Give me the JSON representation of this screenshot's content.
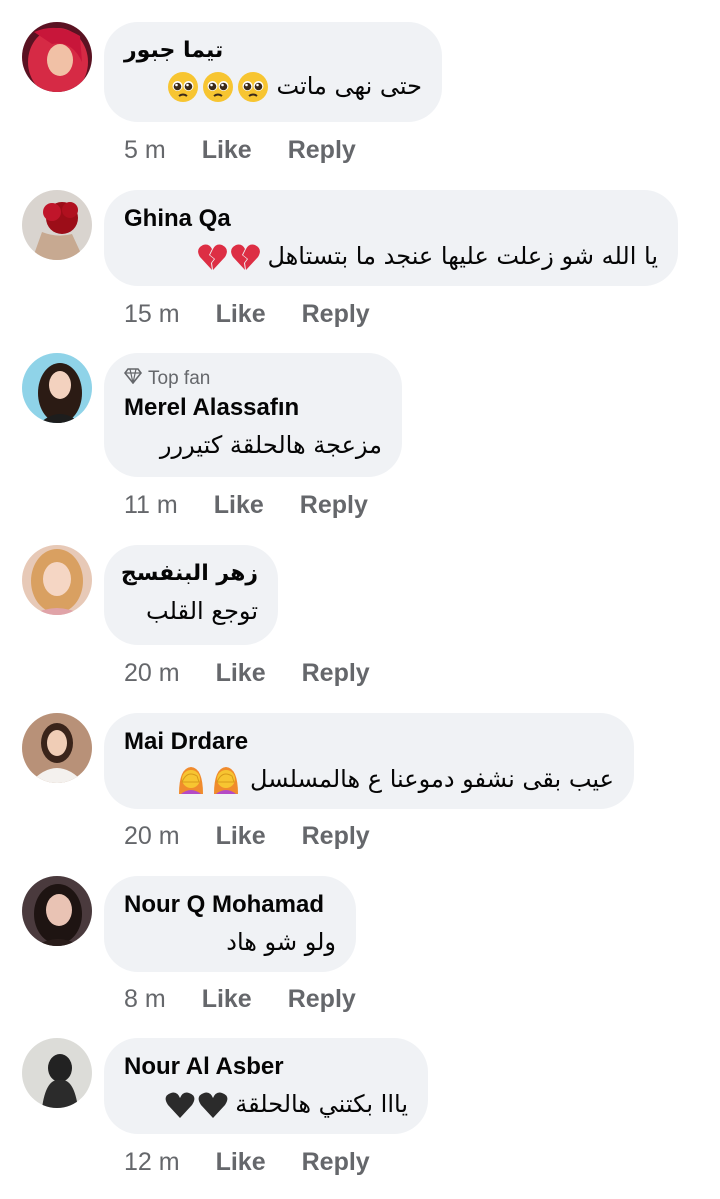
{
  "actions": {
    "like_label": "Like",
    "reply_label": "Reply"
  },
  "top_fan_label": "Top fan",
  "comments": [
    {
      "name": "تيما جبور",
      "text": "حتى نهى ماتت",
      "time": "5 m",
      "emoji": "pleading-face"
    },
    {
      "name": "Ghina Qa",
      "text": "يا الله شو زعلت عليها  عنجد ما بتستاهل",
      "time": "15 m",
      "emoji": "broken-heart"
    },
    {
      "name": "Merel Alassafın",
      "text": "مزعجة هالحلقة كتيررر",
      "time": "11 m",
      "badge": "Top fan"
    },
    {
      "name": "زهر البنفسج",
      "text": "توجع القلب",
      "time": "20 m"
    },
    {
      "name": "Mai Drdare",
      "text": "عيب بقى نشفو دموعنا ع هالمسلسل",
      "time": "20 m",
      "emoji": "facepalm"
    },
    {
      "name": "Nour Q Mohamad",
      "text": "ولو شو هاد",
      "time": "8 m"
    },
    {
      "name": "Nour Al Asber",
      "text": "يااا بكتني هالحلقة",
      "time": "12 m",
      "emoji": "black-heart"
    }
  ]
}
